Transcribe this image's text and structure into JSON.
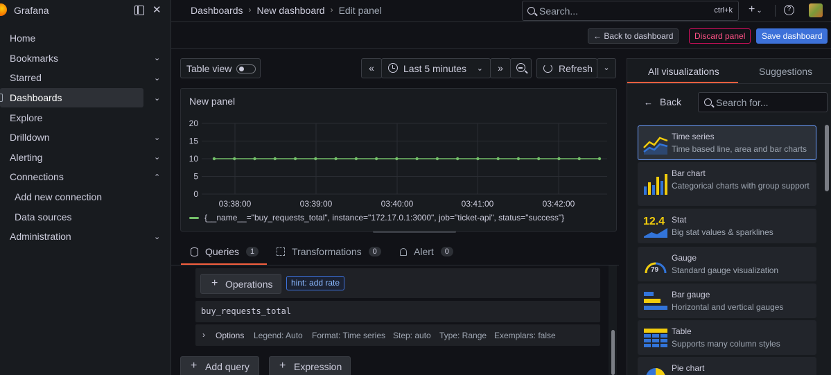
{
  "app": {
    "brand": "Grafana"
  },
  "sidebar": {
    "items": [
      {
        "label": "Home",
        "caret": ""
      },
      {
        "label": "Bookmarks",
        "caret": "⌄"
      },
      {
        "label": "Starred",
        "caret": "⌄"
      },
      {
        "label": "Dashboards",
        "caret": "⌄"
      },
      {
        "label": "Explore",
        "caret": ""
      },
      {
        "label": "Drilldown",
        "caret": "⌄"
      },
      {
        "label": "Alerting",
        "caret": "⌄"
      },
      {
        "label": "Connections",
        "caret": "⌃"
      },
      {
        "label": "Add new connection",
        "caret": ""
      },
      {
        "label": "Data sources",
        "caret": ""
      },
      {
        "label": "Administration",
        "caret": "⌄"
      }
    ]
  },
  "topbar": {
    "breadcrumbs": [
      "Dashboards",
      "New dashboard",
      "Edit panel"
    ],
    "search_placeholder": "Search...",
    "search_shortcut": "ctrl+k"
  },
  "actions": {
    "back": "Back to dashboard",
    "discard": "Discard panel",
    "save": "Save dashboard"
  },
  "controls": {
    "table_view": "Table view",
    "time_range": "Last 5 minutes",
    "refresh": "Refresh"
  },
  "panel": {
    "title": "New panel",
    "legend": "{__name__=\"buy_requests_total\", instance=\"172.17.0.1:3000\", job=\"ticket-api\", status=\"success\"}"
  },
  "chart_data": {
    "type": "line",
    "title": "New panel",
    "yticks": [
      20,
      15,
      10,
      5,
      0
    ],
    "ylim": [
      0,
      20
    ],
    "xticks": [
      "03:38:00",
      "03:39:00",
      "03:40:00",
      "03:41:00",
      "03:42:00"
    ],
    "series": [
      {
        "name": "{__name__=\"buy_requests_total\", instance=\"172.17.0.1:3000\", job=\"ticket-api\", status=\"success\"}",
        "color": "#73bf69",
        "values": [
          10,
          10,
          10,
          10,
          10,
          10,
          10,
          10,
          10,
          10,
          10,
          10,
          10,
          10,
          10,
          10,
          10,
          10,
          10,
          10
        ]
      }
    ],
    "grid": true,
    "legend": "bottom"
  },
  "query_tabs": [
    {
      "label": "Queries",
      "count": "1"
    },
    {
      "label": "Transformations",
      "count": "0"
    },
    {
      "label": "Alert",
      "count": "0"
    }
  ],
  "query": {
    "operations": "Operations",
    "hint": "hint: add rate",
    "expr": "buy_requests_total",
    "options_label": "Options",
    "legend": "Legend: Auto",
    "format": "Format: Time series",
    "step": "Step: auto",
    "type": "Type: Range",
    "exemplars": "Exemplars: false"
  },
  "buttons": {
    "add_query": "Add query",
    "expression": "Expression"
  },
  "viz": {
    "tab_all": "All visualizations",
    "tab_suggestions": "Suggestions",
    "back": "Back",
    "search_placeholder": "Search for...",
    "items": [
      {
        "name": "Time series",
        "desc": "Time based line, area and bar charts",
        "icon": "time-series-icon"
      },
      {
        "name": "Bar chart",
        "desc": "Categorical charts with group support",
        "icon": "bar-chart-icon"
      },
      {
        "name": "Stat",
        "desc": "Big stat values & sparklines",
        "icon": "stat-icon",
        "icon_text": "12.4"
      },
      {
        "name": "Gauge",
        "desc": "Standard gauge visualization",
        "icon": "gauge-icon",
        "icon_text": "79"
      },
      {
        "name": "Bar gauge",
        "desc": "Horizontal and vertical gauges",
        "icon": "bar-gauge-icon"
      },
      {
        "name": "Table",
        "desc": "Supports many column styles",
        "icon": "table-icon"
      },
      {
        "name": "Pie chart",
        "desc": "",
        "icon": "pie-chart-icon"
      }
    ]
  }
}
